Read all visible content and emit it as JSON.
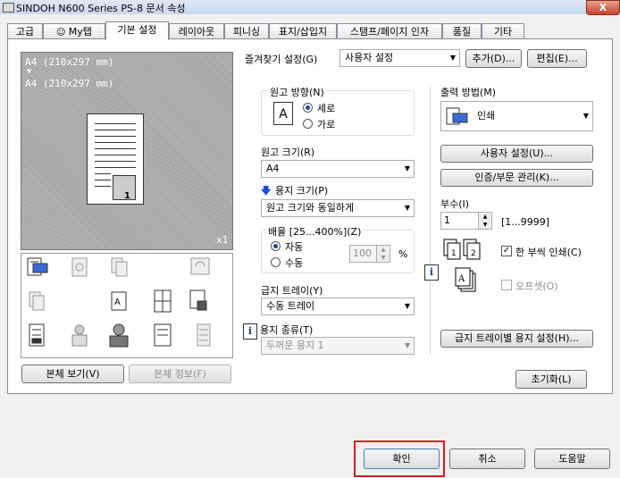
{
  "window": {
    "title": "SINDOH N600 Series PS-8 문서 속성",
    "close": "X"
  },
  "tabs": [
    {
      "label": "고급"
    },
    {
      "label": "My탭"
    },
    {
      "label": "기본 설정"
    },
    {
      "label": "레이아웃"
    },
    {
      "label": "피니싱"
    },
    {
      "label": "표지/삽입지"
    },
    {
      "label": "스탬프/페이지 인자"
    },
    {
      "label": "품질"
    },
    {
      "label": "기타"
    }
  ],
  "preview": {
    "line1": "A4 (210x297 mm)",
    "arrow": "▼",
    "line2": "A4 (210x297 mm)",
    "scale": "x1",
    "page_number": "1"
  },
  "preview_buttons": {
    "view": "본체 보기(V)",
    "info": "본체 정보(F)"
  },
  "favorites": {
    "label": "즐겨찾기 설정(G)",
    "value": "사용자 설정",
    "add": "추가(D)...",
    "edit": "편집(E)..."
  },
  "orientation": {
    "label": "원고 방향(N)",
    "portrait": "세로",
    "landscape": "가로",
    "selected": "portrait",
    "glyph": "A"
  },
  "original_size": {
    "label": "원고 크기(R)",
    "value": "A4"
  },
  "paper_size": {
    "label": "용지 크기(P)",
    "value": "원고 크기와 동일하게"
  },
  "zoom": {
    "label": "배율 [25...400%](Z)",
    "auto": "자동",
    "manual": "수동",
    "value": "100",
    "unit": "%"
  },
  "tray": {
    "label": "급지 트레이(Y)",
    "value": "수동 트레이"
  },
  "paper_type": {
    "label": "용지 종류(T)",
    "value": "두꺼운 용지 1"
  },
  "output": {
    "label": "출력 방법(M)",
    "value": "인쇄",
    "user_settings": "사용자 설정(U)...",
    "auth": "인증/부문 관리(K)..."
  },
  "copies": {
    "label": "부수(I)",
    "value": "1",
    "range": "[1...9999]",
    "collate": "한 부씩 인쇄(C)",
    "collate_checked": true,
    "offset": "오프셋(O)",
    "offset_checked": false
  },
  "tray_paper_button": "급지 트레이별 용지 설정(H)...",
  "reset_button": "초기화(L)",
  "dialog_buttons": {
    "ok": "확인",
    "cancel": "취소",
    "help": "도움말"
  },
  "icons": {
    "info": "i",
    "arrow_down_blue": "🡇"
  }
}
